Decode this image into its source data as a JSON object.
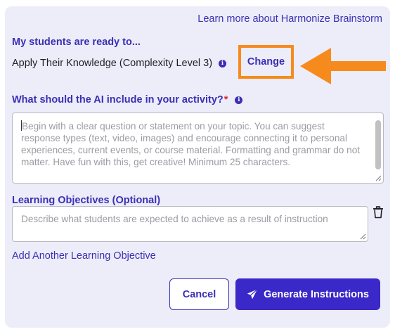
{
  "header": {
    "learn_more_link": "Learn more about Harmonize Brainstorm"
  },
  "readiness": {
    "heading": "My students are ready to...",
    "complexity_label": "Apply Their Knowledge (Complexity Level 3)",
    "change_link": "Change"
  },
  "activity": {
    "heading": "What should the AI include in your activity?",
    "required_marker": "*",
    "placeholder": "Begin with a clear question or statement on your topic. You can suggest response types (text, video, images) and encourage connecting it to personal experiences, current events, or course material. Formatting and grammar do not matter.  Have fun with this, get creative!  Minimum 25 characters."
  },
  "learning_objectives": {
    "heading": "Learning Objectives (Optional)",
    "placeholder": "Describe what students are expected to achieve as a result of instruction",
    "add_link": "Add Another Learning Objective"
  },
  "actions": {
    "cancel_label": "Cancel",
    "generate_label": "Generate Instructions"
  },
  "icons": {
    "info": "info-icon",
    "trash": "trash-icon",
    "send": "paper-plane-icon",
    "annotation_arrow": "left-arrow-icon"
  },
  "colors": {
    "accent": "#3b2fb5",
    "primary_button": "#3b28c8",
    "highlight_annotation": "#f78a1d",
    "required": "#e0283a",
    "panel_background": "#ecedf8"
  }
}
